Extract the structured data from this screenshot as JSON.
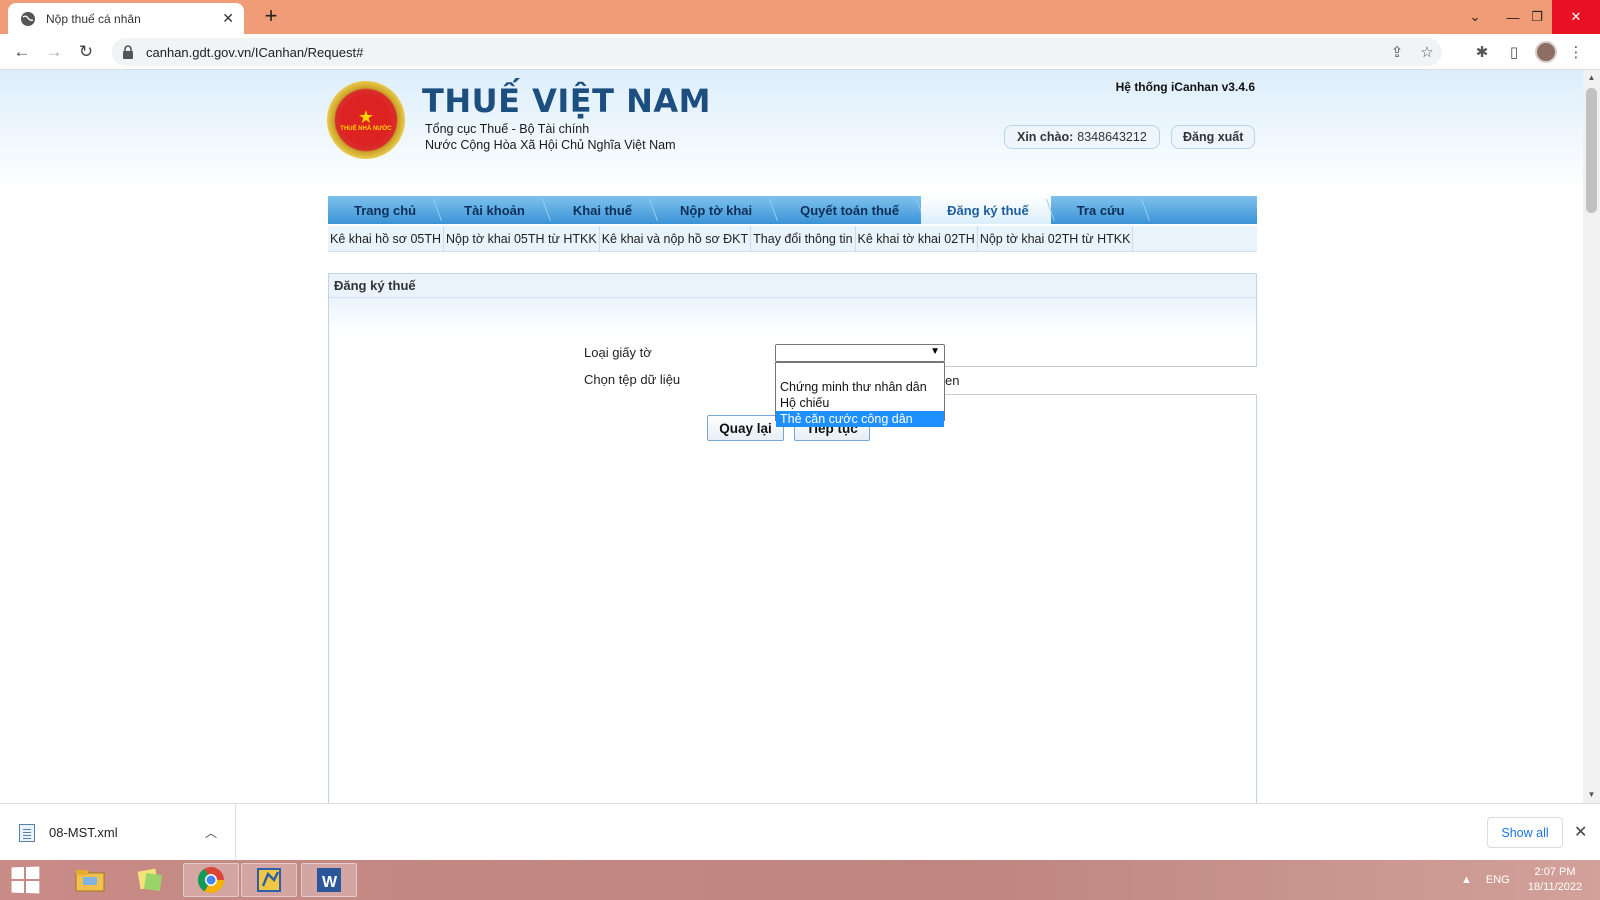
{
  "browser": {
    "tab_title": "Nộp thuế cá nhân",
    "url": "canhan.gdt.gov.vn/ICanhan/Request#"
  },
  "header": {
    "emblem_text": "THUẾ NHÀ NƯỚC",
    "title": "THUẾ VIỆT NAM",
    "subtitle1": "Tổng cục Thuế - Bộ Tài chính",
    "subtitle2": "Nước Cộng Hòa Xã Hội Chủ Nghĩa Việt Nam",
    "system_version": "Hệ thống iCanhan v3.4.6",
    "greeting_label": "Xin chào:",
    "user_id": "8348643212",
    "logout": "Đăng xuất"
  },
  "main_nav": [
    {
      "label": "Trang chủ"
    },
    {
      "label": "Tài khoản"
    },
    {
      "label": "Khai thuế"
    },
    {
      "label": "Nộp tờ khai"
    },
    {
      "label": "Quyết toán thuế"
    },
    {
      "label": "Đăng ký thuế",
      "active": true
    },
    {
      "label": "Tra cứu"
    }
  ],
  "sub_nav": [
    {
      "label": "Kê khai hồ sơ 05TH"
    },
    {
      "label": "Nộp tờ khai 05TH từ HTKK"
    },
    {
      "label": "Kê khai và nộp hồ sơ ĐKT"
    },
    {
      "label": "Thay đổi thông tin"
    },
    {
      "label": "Kê khai tờ khai 02TH"
    },
    {
      "label": "Nộp tờ khai 02TH từ HTKK"
    }
  ],
  "panel": {
    "title": "Đăng ký thuế",
    "doc_type_label": "Loại giấy tờ",
    "doc_type_value": "",
    "file_label": "Chọn tệp dữ liệu",
    "file_field_partial": "en",
    "back_button": "Quay lại",
    "next_button": "Tiếp tục",
    "dropdown_options": [
      {
        "label": ""
      },
      {
        "label": "Chứng minh thư nhân dân"
      },
      {
        "label": "Hộ chiếu"
      },
      {
        "label": "Thẻ căn cước công dân",
        "highlighted": true
      }
    ]
  },
  "downloads": {
    "file_name": "08-MST.xml",
    "show_all": "Show all"
  },
  "taskbar": {
    "language": "ENG",
    "time": "2:07 PM",
    "date": "18/11/2022"
  },
  "colors": {
    "titlebar": "#ef9c77",
    "brand_blue": "#1c4e80",
    "nav_blue": "#3b93d6",
    "highlight": "#1e90ff"
  }
}
